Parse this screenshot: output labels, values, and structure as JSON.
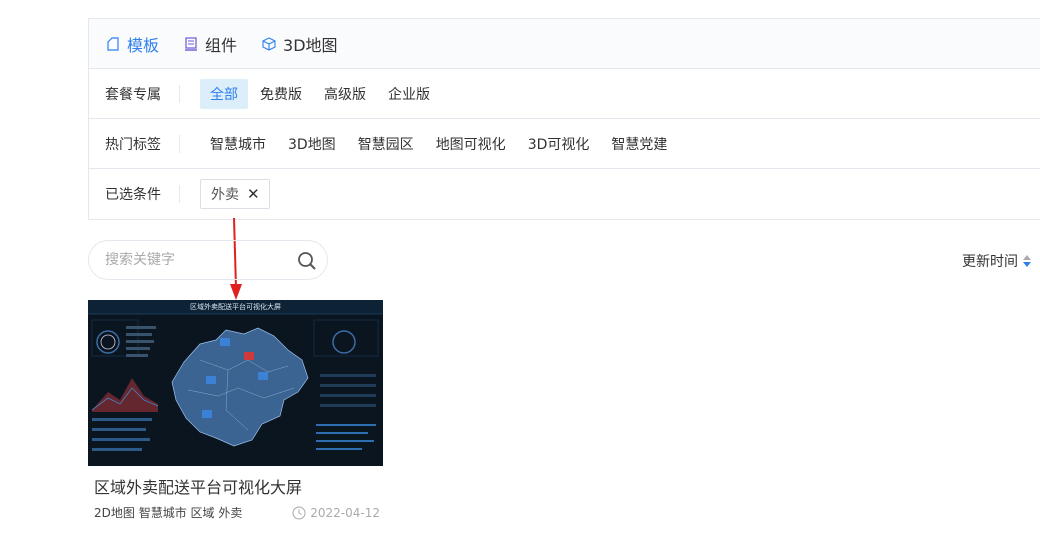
{
  "tabs": [
    {
      "label": "模板",
      "icon": "template-icon",
      "active": true
    },
    {
      "label": "组件",
      "icon": "component-icon",
      "active": false
    },
    {
      "label": "3D地图",
      "icon": "cube-icon",
      "active": false
    }
  ],
  "plan": {
    "label": "套餐专属",
    "options": [
      "全部",
      "免费版",
      "高级版",
      "企业版"
    ],
    "selected": "全部"
  },
  "hot_tags": {
    "label": "热门标签",
    "options": [
      "智慧城市",
      "3D地图",
      "智慧园区",
      "地图可视化",
      "3D可视化",
      "智慧党建"
    ]
  },
  "selected_conditions": {
    "label": "已选条件",
    "chips": [
      "外卖"
    ]
  },
  "search": {
    "placeholder": "搜索关键字",
    "value": ""
  },
  "sort": {
    "label": "更新时间"
  },
  "card": {
    "title": "区域外卖配送平台可视化大屏",
    "thumb_title": "区域外卖配送平台可视化大屏",
    "tags": "2D地图 智慧城市 区域 外卖",
    "date": "2022-04-12"
  },
  "colors": {
    "accent": "#2f80ed",
    "arrow": "#e02020"
  }
}
